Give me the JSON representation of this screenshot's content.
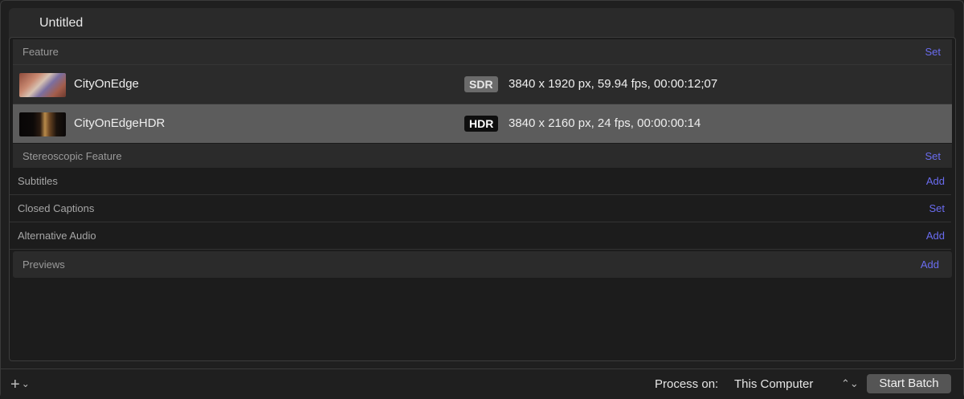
{
  "window": {
    "title": "Untitled"
  },
  "feature": {
    "label": "Feature",
    "action": "Set",
    "items": [
      {
        "name": "CityOnEdge",
        "badge": "SDR",
        "info": "3840 x 1920 px, 59.94 fps, 00:00:12;07",
        "selected": false
      },
      {
        "name": "CityOnEdgeHDR",
        "badge": "HDR",
        "info": "3840 x 2160 px, 24 fps, 00:00:00:14",
        "selected": true
      }
    ]
  },
  "stereoscopic": {
    "label": "Stereoscopic Feature",
    "action": "Set"
  },
  "subtitles": {
    "label": "Subtitles",
    "action": "Add"
  },
  "closed_captions": {
    "label": "Closed Captions",
    "action": "Set"
  },
  "alternative_audio": {
    "label": "Alternative Audio",
    "action": "Add"
  },
  "previews": {
    "label": "Previews",
    "action": "Add"
  },
  "footer": {
    "add_icon": "plus-icon",
    "add_chevron": "chevron-down-icon",
    "process_label": "Process on:",
    "process_value": "This Computer",
    "start_label": "Start Batch"
  },
  "colors": {
    "accent": "#6a6cf0",
    "selected_row": "#5c5c5c"
  }
}
